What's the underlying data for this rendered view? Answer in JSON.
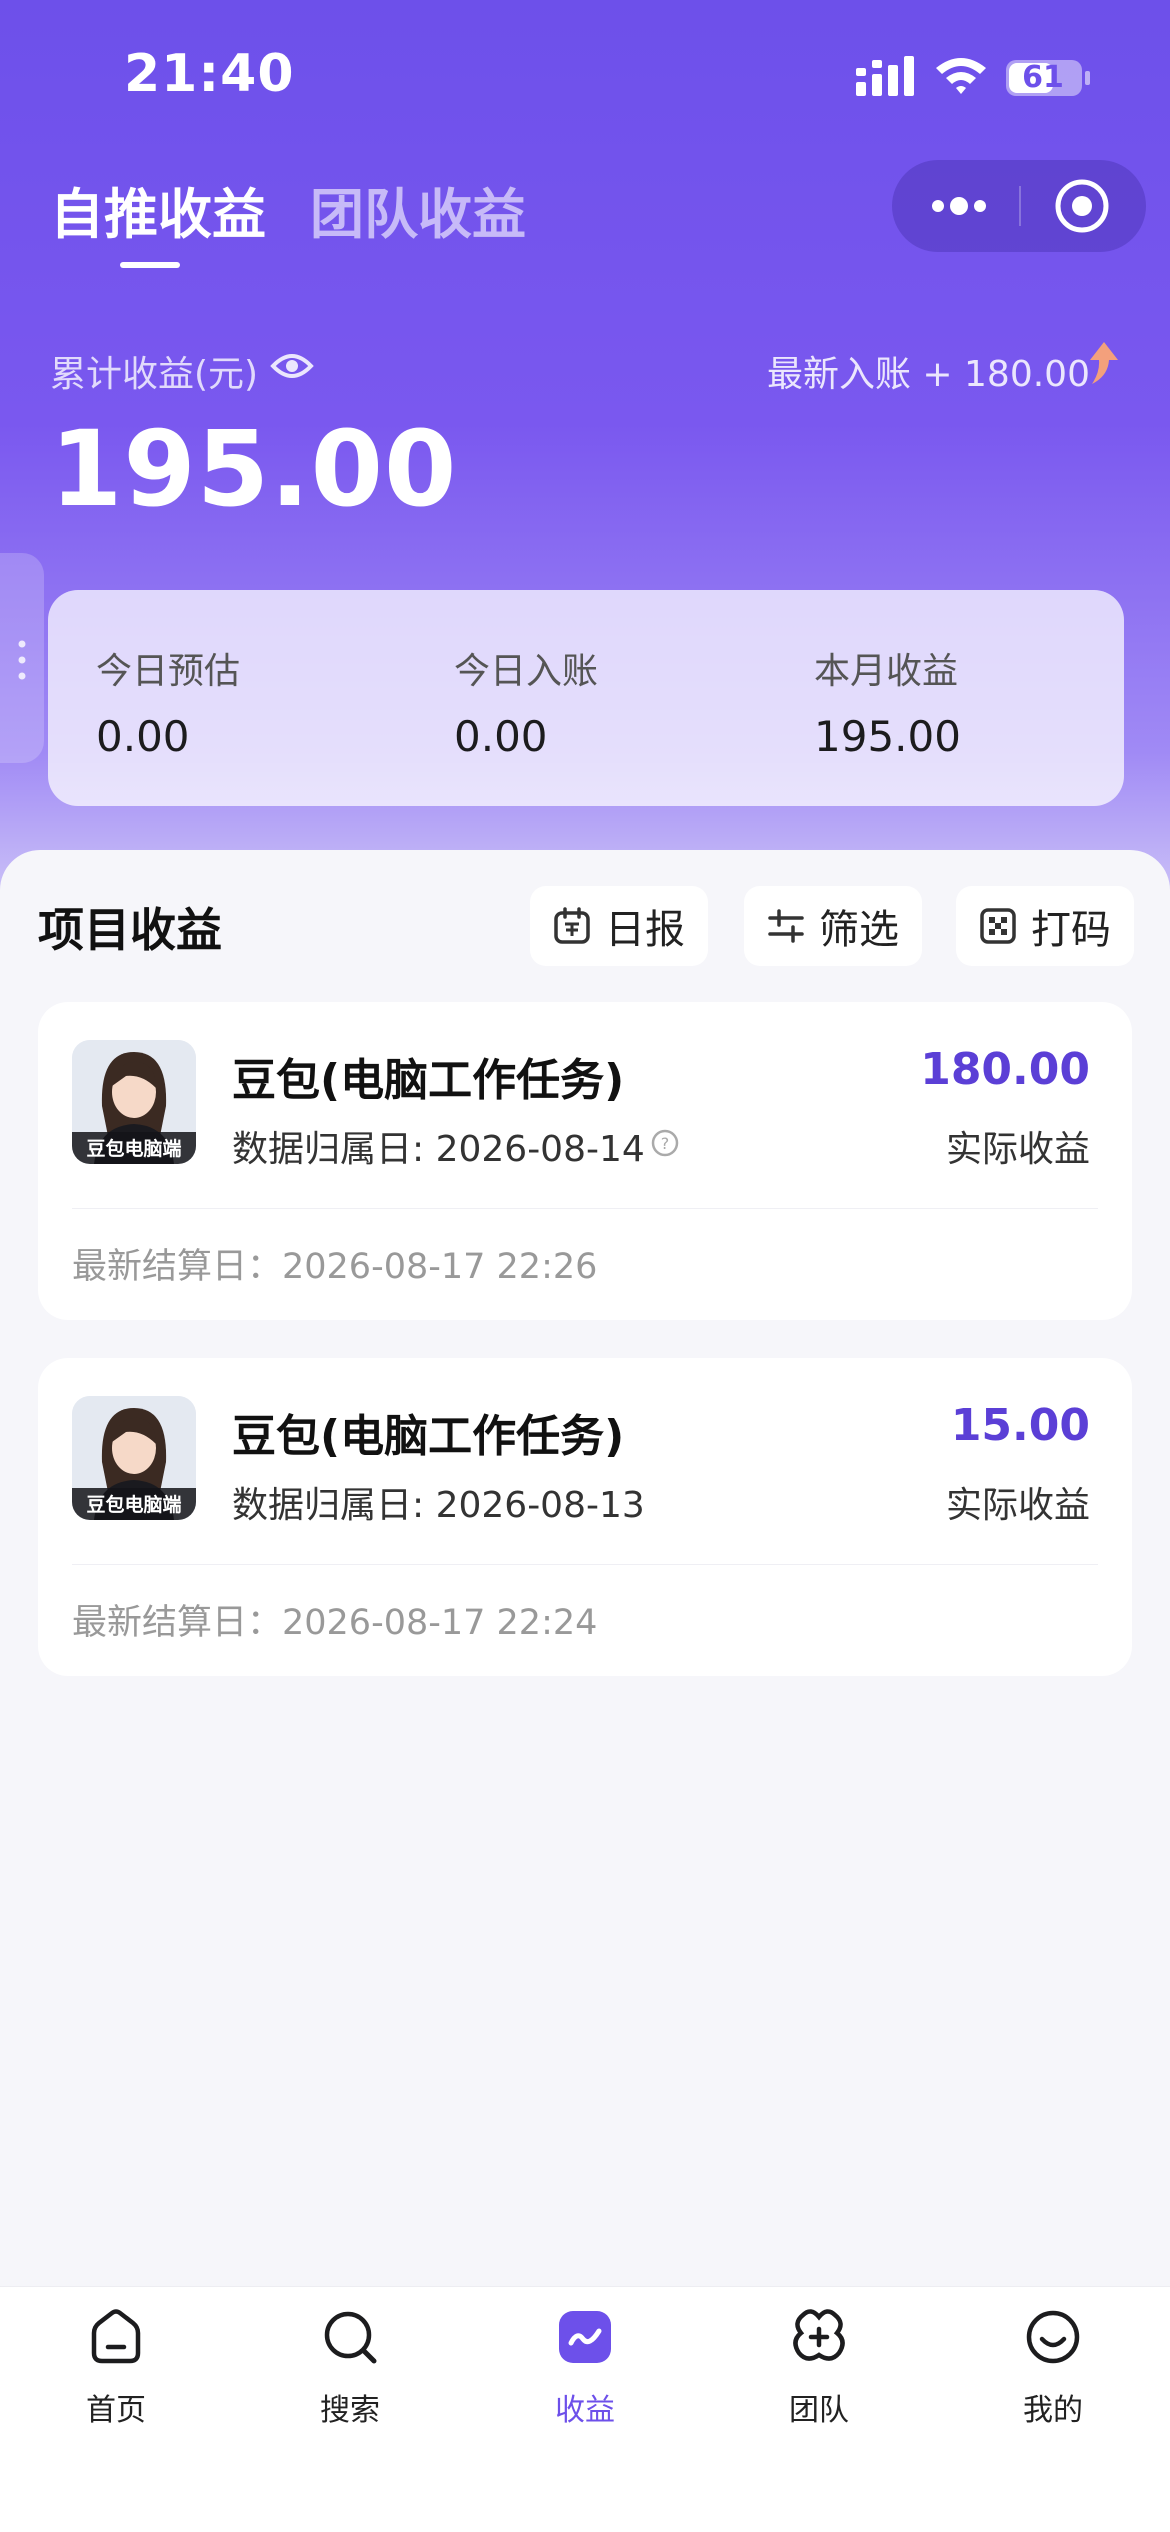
{
  "status_bar": {
    "time": "21:40",
    "battery": "61"
  },
  "tabs": [
    {
      "label": "自推收益",
      "active": true
    },
    {
      "label": "团队收益",
      "active": false
    }
  ],
  "summary": {
    "cumulative_label": "累计收益(元)",
    "cumulative_amount": "195.00",
    "latest_income": "最新入账 + 180.00"
  },
  "stats": [
    {
      "label": "今日预估",
      "value": "0.00"
    },
    {
      "label": "今日入账",
      "value": "0.00"
    },
    {
      "label": "本月收益",
      "value": "195.00"
    }
  ],
  "section": {
    "title": "项目收益",
    "buttons": {
      "report": "日报",
      "filter": "筛选",
      "print": "打码"
    }
  },
  "projects": [
    {
      "name": "豆包(电脑工作任务)",
      "avatar_caption": "豆包电脑端",
      "date": "数据归属日: 2026-08-14",
      "amount": "180.00",
      "amount_label": "实际收益",
      "settle": "最新结算日：2026-08-17 22:26"
    },
    {
      "name": "豆包(电脑工作任务)",
      "avatar_caption": "豆包电脑端",
      "date": "数据归属日: 2026-08-13",
      "amount": "15.00",
      "amount_label": "实际收益",
      "settle": "最新结算日：2026-08-17 22:24"
    }
  ],
  "nav": [
    {
      "label": "首页",
      "icon": "home-icon"
    },
    {
      "label": "搜索",
      "icon": "search-icon"
    },
    {
      "label": "收益",
      "icon": "earnings-icon",
      "active": true
    },
    {
      "label": "团队",
      "icon": "team-icon"
    },
    {
      "label": "我的",
      "icon": "profile-icon"
    }
  ],
  "colors": {
    "accent": "#6d50ea",
    "amount": "#5b3fd6",
    "page_bg": "#f6f6fa"
  }
}
